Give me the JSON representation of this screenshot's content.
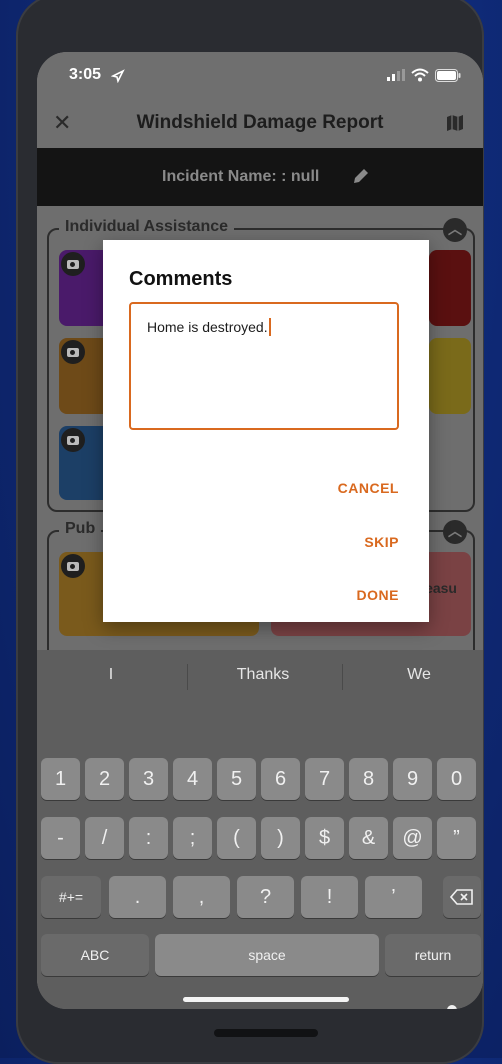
{
  "status_bar": {
    "time": "3:05"
  },
  "header": {
    "title": "Windshield Damage Report"
  },
  "incident": {
    "label": "Incident Name: : null"
  },
  "sections": [
    {
      "label": "Individual Assistance"
    },
    {
      "label": "Pub"
    }
  ],
  "background_tile_text": "easu",
  "dialog": {
    "title": "Comments",
    "comment_value": "Home is destroyed.",
    "cancel_label": "CANCEL",
    "skip_label": "SKIP",
    "done_label": "DONE",
    "accent_color": "#d9691f"
  },
  "keyboard": {
    "suggestions": [
      "I",
      "Thanks",
      "We"
    ],
    "row1": [
      "1",
      "2",
      "3",
      "4",
      "5",
      "6",
      "7",
      "8",
      "9",
      "0"
    ],
    "row2": [
      "-",
      "/",
      ":",
      ";",
      "(",
      ")",
      "$",
      "&",
      "@",
      "”"
    ],
    "row3_left": "#+=",
    "row3": [
      ".",
      ",",
      "?",
      "!",
      "’"
    ],
    "abc_label": "ABC",
    "space_label": "space",
    "return_label": "return"
  }
}
